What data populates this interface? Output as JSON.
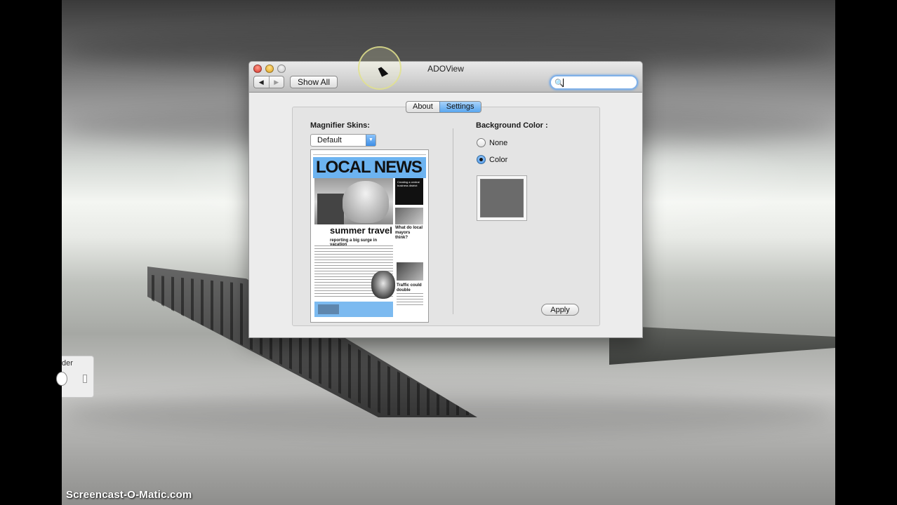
{
  "window": {
    "title": "ADOView",
    "show_all_label": "Show All",
    "search": {
      "value": "",
      "placeholder": ""
    }
  },
  "tabs": [
    {
      "label": "About",
      "active": false
    },
    {
      "label": "Settings",
      "active": true
    }
  ],
  "magnifier": {
    "label": "Magnifier Skins:",
    "selected_skin": "Default",
    "preview": {
      "headline": "LOCAL NEWS",
      "banner": "summer travel",
      "subhead": "reporting a big surge in vacation",
      "side_caption_1": "What do local mayors think?",
      "side_caption_2": "Traffic could double",
      "side_box_text": "Creating a central business district"
    }
  },
  "background": {
    "label": "Background Color :",
    "options": [
      {
        "label": "None",
        "selected": false
      },
      {
        "label": "Color",
        "selected": true
      }
    ],
    "swatch_color": "#6b6b6b"
  },
  "apply_label": "Apply",
  "side_panel_label": "der",
  "watermark": "Screencast-O-Matic.com",
  "colors": {
    "accent": "#5aa7ef",
    "close": "#d9352a",
    "minimize": "#e0a21c",
    "newspaper_blue": "#6cb3f0"
  },
  "icons": {
    "back": "left-arrow-icon",
    "forward": "right-arrow-icon",
    "search": "magnifier-icon",
    "popup": "chevron-down-icon"
  }
}
